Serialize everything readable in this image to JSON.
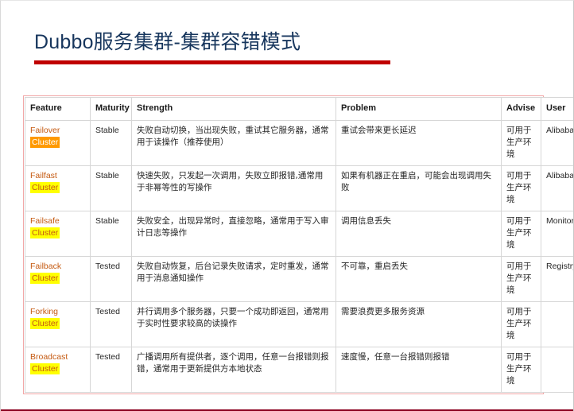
{
  "slide": {
    "title": "Dubbo服务集群-集群容错模式",
    "title_color": "#17365D",
    "accent_color": "#C00000",
    "bottom_rule_color": "#8B0020",
    "table_border_color": "#F2A7A7"
  },
  "table": {
    "headers": {
      "feature": "Feature",
      "maturity": "Maturity",
      "strength": "Strength",
      "problem": "Problem",
      "advise": "Advise",
      "user": "User"
    },
    "highlight_colors": {
      "orange": "#FF9900",
      "yellow": "#FFFF00",
      "feature_text": "#C55A11"
    },
    "rows": [
      {
        "feature_word": "Failover",
        "feature_chip": "Cluster",
        "chip_style": "orange",
        "maturity": "Stable",
        "strength": "失败自动切换，当出现失败，重试其它服务器，通常用于读操作（推荐使用）",
        "problem": "重试会带来更长延迟",
        "advise": "可用于生产环境",
        "user": "Alibaba"
      },
      {
        "feature_word": "Failfast",
        "feature_chip": "Cluster",
        "chip_style": "yellow",
        "maturity": "Stable",
        "strength": "快速失败，只发起一次调用，失败立即报错,通常用于非幂等性的写操作",
        "problem": "如果有机器正在重启，可能会出现调用失败",
        "advise": "可用于生产环境",
        "user": "Alibaba"
      },
      {
        "feature_word": "Failsafe",
        "feature_chip": "Cluster",
        "chip_style": "yellow",
        "maturity": "Stable",
        "strength": "失败安全，出现异常时，直接忽略，通常用于写入审计日志等操作",
        "problem": "调用信息丢失",
        "advise": "可用于生产环境",
        "user": "Monitor"
      },
      {
        "feature_word": "Failback",
        "feature_chip": "Cluster",
        "chip_style": "yellow",
        "maturity": "Tested",
        "strength": "失败自动恢复，后台记录失败请求，定时重发，通常用于消息通知操作",
        "problem": "不可靠，重启丢失",
        "advise": "可用于生产环境",
        "user": "Registry"
      },
      {
        "feature_word": "Forking",
        "feature_chip": "Cluster",
        "chip_style": "yellow",
        "maturity": "Tested",
        "strength": "并行调用多个服务器，只要一个成功即返回，通常用于实时性要求较高的读操作",
        "problem": "需要浪费更多服务资源",
        "advise": "可用于生产环境",
        "user": ""
      },
      {
        "feature_word": "Broadcast",
        "feature_chip": "Cluster",
        "chip_style": "yellow",
        "maturity": "Tested",
        "strength": "广播调用所有提供者，逐个调用，任意一台报错则报错，通常用于更新提供方本地状态",
        "problem": "速度慢，任意一台报错则报错",
        "advise": "可用于生产环境",
        "user": ""
      }
    ]
  }
}
